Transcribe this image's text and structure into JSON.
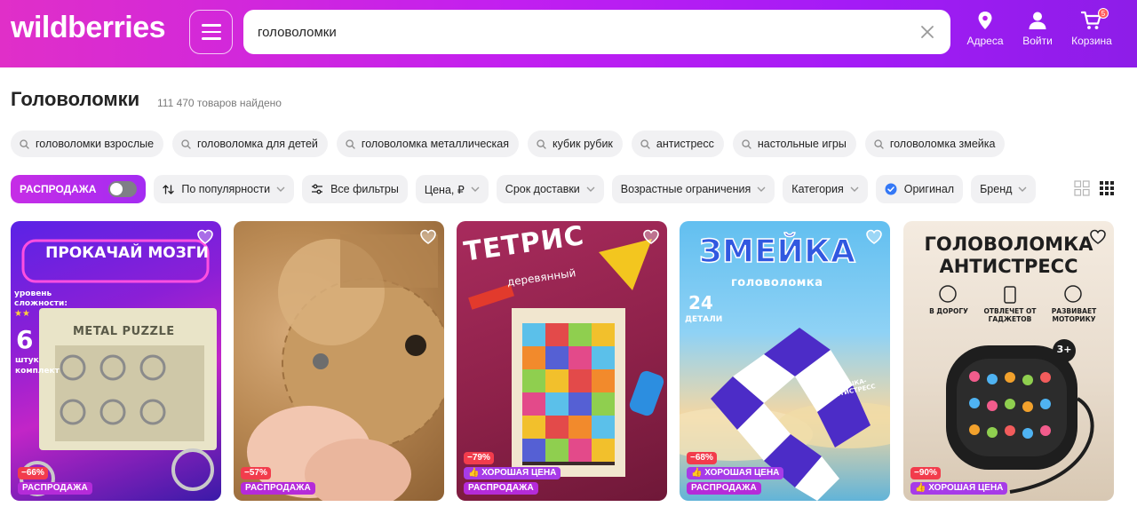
{
  "header": {
    "logo": "wildberries",
    "search_value": "головоломки",
    "addresses_label": "Адреса",
    "login_label": "Войти",
    "cart_label": "Корзина",
    "cart_count": "5"
  },
  "page": {
    "title": "Головоломки",
    "count": "111 470 товаров найдено"
  },
  "suggestions": [
    "головоломки взрослые",
    "головоломка для детей",
    "головоломка металлическая",
    "кубик рубик",
    "антистресс",
    "настольные игры",
    "головоломка змейка"
  ],
  "filters": {
    "sale_label": "РАСПРОДАЖА",
    "sort": "По популярности",
    "all_filters": "Все фильтры",
    "price": "Цена, ₽",
    "delivery": "Срок доставки",
    "age": "Возрастные ограничения",
    "category": "Категория",
    "original": "Оригинал",
    "brand": "Бренд"
  },
  "products": [
    {
      "discount": "−66%",
      "tags": [
        "РАСПРОДАЖА"
      ],
      "image_text": {
        "banner": "ПРОКАЧАЙ МОЗГИ",
        "level_label": "уровень сложности:",
        "stars": "★★",
        "count_num": "6",
        "count_unit": "штук",
        "count_word": "комплект",
        "box_title": "METAL PUZZLE"
      }
    },
    {
      "discount": "−57%",
      "tags": [
        "РАСПРОДАЖА"
      ],
      "image_text": {}
    },
    {
      "discount": "−79%",
      "tags": [
        "ХОРОШАЯ ЦЕНА",
        "РАСПРОДАЖА"
      ],
      "image_text": {
        "title": "ТЕТРИС",
        "subtitle": "деревянный"
      }
    },
    {
      "discount": "−68%",
      "tags": [
        "ХОРОШАЯ ЦЕНА",
        "РАСПРОДАЖА"
      ],
      "image_text": {
        "title": "ЗМЕЙКА",
        "subtitle": "головоломка",
        "pieces_num": "24",
        "pieces_word": "ДЕТАЛИ",
        "note": "ИГРУШКА-АНТИСТРЕСС"
      }
    },
    {
      "discount": "−90%",
      "tags": [
        "ХОРОШАЯ ЦЕНА"
      ],
      "image_text": {
        "title_line1": "ГОЛОВОЛОМКА",
        "title_line2": "АНТИСТРЕСС",
        "feature1": "В ДОРОГУ",
        "feature2": "ОТВЛЕЧЕТ ОТ ГАДЖЕТОВ",
        "feature3": "РАЗВИВАЕТ МОТОРИКУ",
        "age": "3+"
      }
    }
  ]
}
